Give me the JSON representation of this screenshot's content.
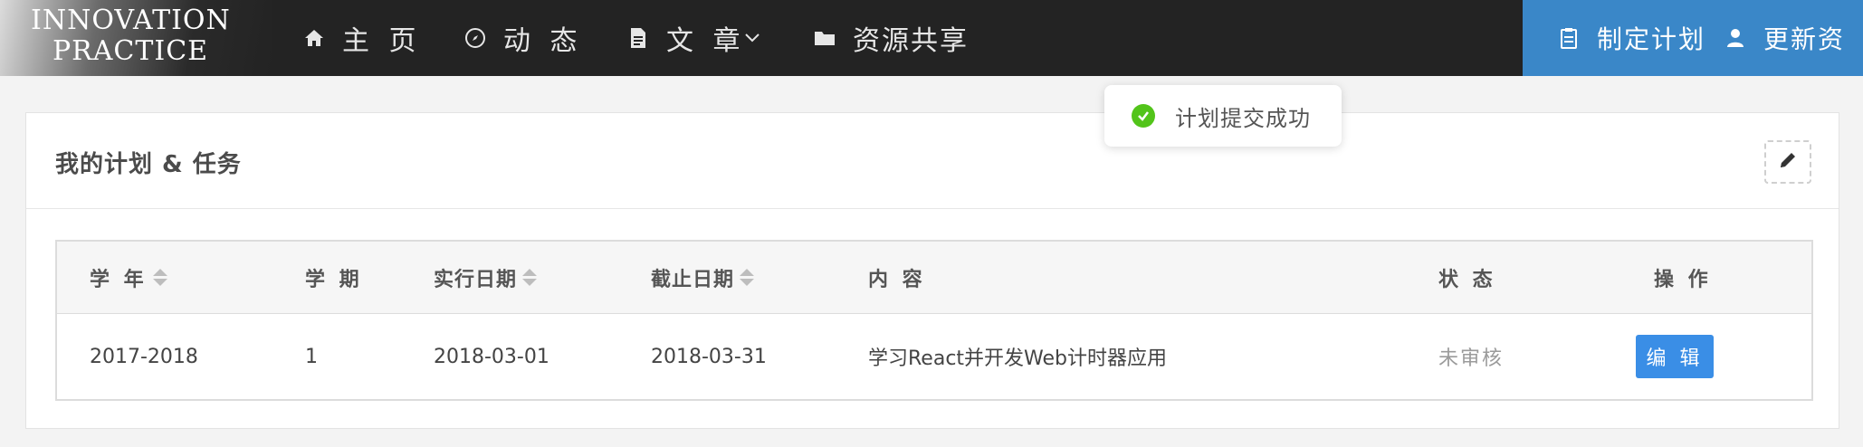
{
  "nav": {
    "logo_line1": "INNOVATION",
    "logo_line2": "PRACTICE",
    "items": [
      {
        "label": "主 页",
        "icon": "home-icon"
      },
      {
        "label": "动 态",
        "icon": "compass-icon"
      },
      {
        "label": "文 章",
        "icon": "document-icon"
      },
      {
        "label": "资源共享",
        "icon": "folder-icon"
      }
    ],
    "right_items": [
      {
        "label": "制定计划",
        "icon": "clipboard-icon"
      },
      {
        "label": "更新资",
        "icon": "user-icon"
      }
    ]
  },
  "toast": {
    "message": "计划提交成功",
    "color": "#52c41a"
  },
  "panel": {
    "title": "我的计划 & 任务"
  },
  "table": {
    "columns": [
      "学 年",
      "学 期",
      "实行日期",
      "截止日期",
      "内 容",
      "状 态",
      "操 作"
    ],
    "rows": [
      {
        "year": "2017-2018",
        "term": "1",
        "start_date": "2018-03-01",
        "end_date": "2018-03-31",
        "content": "学习React并开发Web计时器应用",
        "status": "未审核",
        "action": "编 辑"
      }
    ]
  },
  "colors": {
    "nav_bg": "#232323",
    "nav_right_bg": "#3a87c8",
    "button_blue": "#3a8ee6"
  }
}
